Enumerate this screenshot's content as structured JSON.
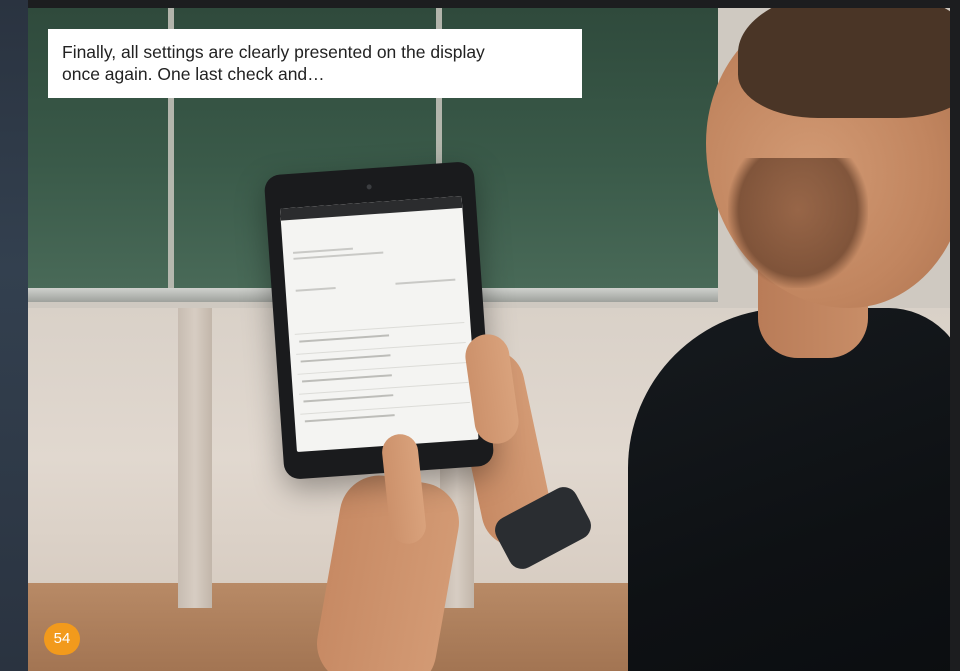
{
  "caption": {
    "line1": "Finally, all settings are clearly presented on the display",
    "line2": "once again. One last check and…"
  },
  "page_number": "54",
  "colors": {
    "badge": "#f29a1c",
    "caption_bg": "#ffffff",
    "caption_text": "#222222"
  },
  "photo": {
    "subject": "man-holding-tablet-in-classroom"
  }
}
